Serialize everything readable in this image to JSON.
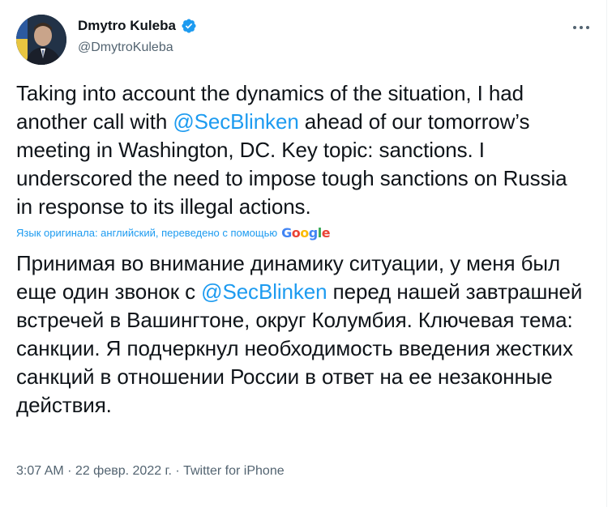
{
  "user": {
    "name": "Dmytro Kuleba",
    "handle": "@DmytroKuleba"
  },
  "tweet": {
    "en_before": "Taking into account the dynamics of the situation, I had another call with ",
    "en_mention": "@SecBlinken",
    "en_after": " ahead of our tomorrow’s meeting in Washington, DC. Key topic: sanctions. I underscored the need to impose tough sanctions on Russia in response to its illegal actions.",
    "translation_note": "Язык оригинала: английский, переведено с помощью",
    "translation_brand": "Google",
    "ru_before": "Принимая во внимание динамику ситуации, у меня был еще один звонок с ",
    "ru_mention": "@SecBlinken",
    "ru_after": " перед нашей завтрашней встречей в Вашингтоне, округ Колумбия. Ключевая тема: санкции. Я подчеркнул необходимость введения жестких санкций в отношении России в ответ на ее незаконные действия."
  },
  "meta": {
    "time": "3:07 AM",
    "separator": " · ",
    "date": "22 февр. 2022 г.",
    "source": "Twitter for iPhone"
  },
  "colors": {
    "accent": "#1d9bf0",
    "text": "#0f1419",
    "secondary": "#536471"
  },
  "icons": {
    "verified": "verified-badge-icon",
    "more": "more-options-icon"
  }
}
